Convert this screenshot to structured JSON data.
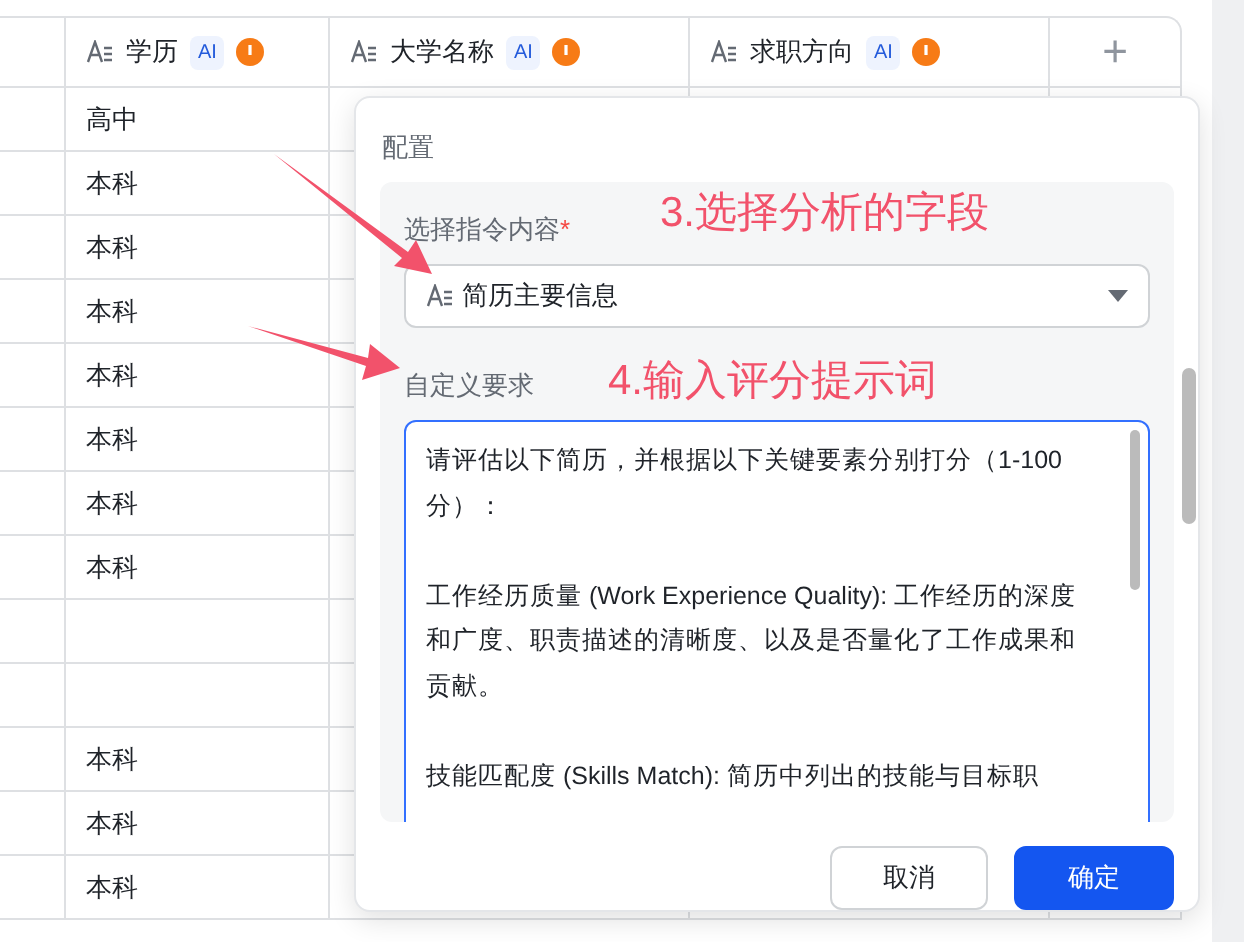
{
  "table": {
    "columns": [
      {
        "label": "学历",
        "badge": "AI"
      },
      {
        "label": "大学名称",
        "badge": "AI"
      },
      {
        "label": "求职方向",
        "badge": "AI"
      }
    ],
    "add_column": "+",
    "rows": [
      {
        "education": "高中"
      },
      {
        "education": "本科"
      },
      {
        "education": "本科"
      },
      {
        "education": "本科"
      },
      {
        "education": "本科"
      },
      {
        "education": "本科"
      },
      {
        "education": "本科"
      },
      {
        "education": "本科"
      },
      {
        "education": ""
      },
      {
        "education": ""
      },
      {
        "education": "本科"
      },
      {
        "education": "本科"
      },
      {
        "education": "本科"
      }
    ]
  },
  "dialog": {
    "title": "配置",
    "instruction_label": "选择指令内容",
    "required_mark": "*",
    "selected_field": "简历主要信息",
    "custom_label": "自定义要求",
    "prompt_paragraphs": [
      "请评估以下简历，并根据以下关键要素分别打分（1-100 分）：",
      "工作经历质量 (Work Experience Quality): 工作经历的深度和广度、职责描述的清晰度、以及是否量化了工作成果和贡献。",
      "技能匹配度 (Skills Match): 简历中列出的技能与目标职"
    ],
    "buttons": [
      {
        "label": "取消",
        "kind": "secondary"
      },
      {
        "label": "确定",
        "kind": "primary"
      }
    ]
  },
  "annotations": [
    {
      "text": "3.选择分析的字段"
    },
    {
      "text": "4.输入评分提示词"
    }
  ]
}
